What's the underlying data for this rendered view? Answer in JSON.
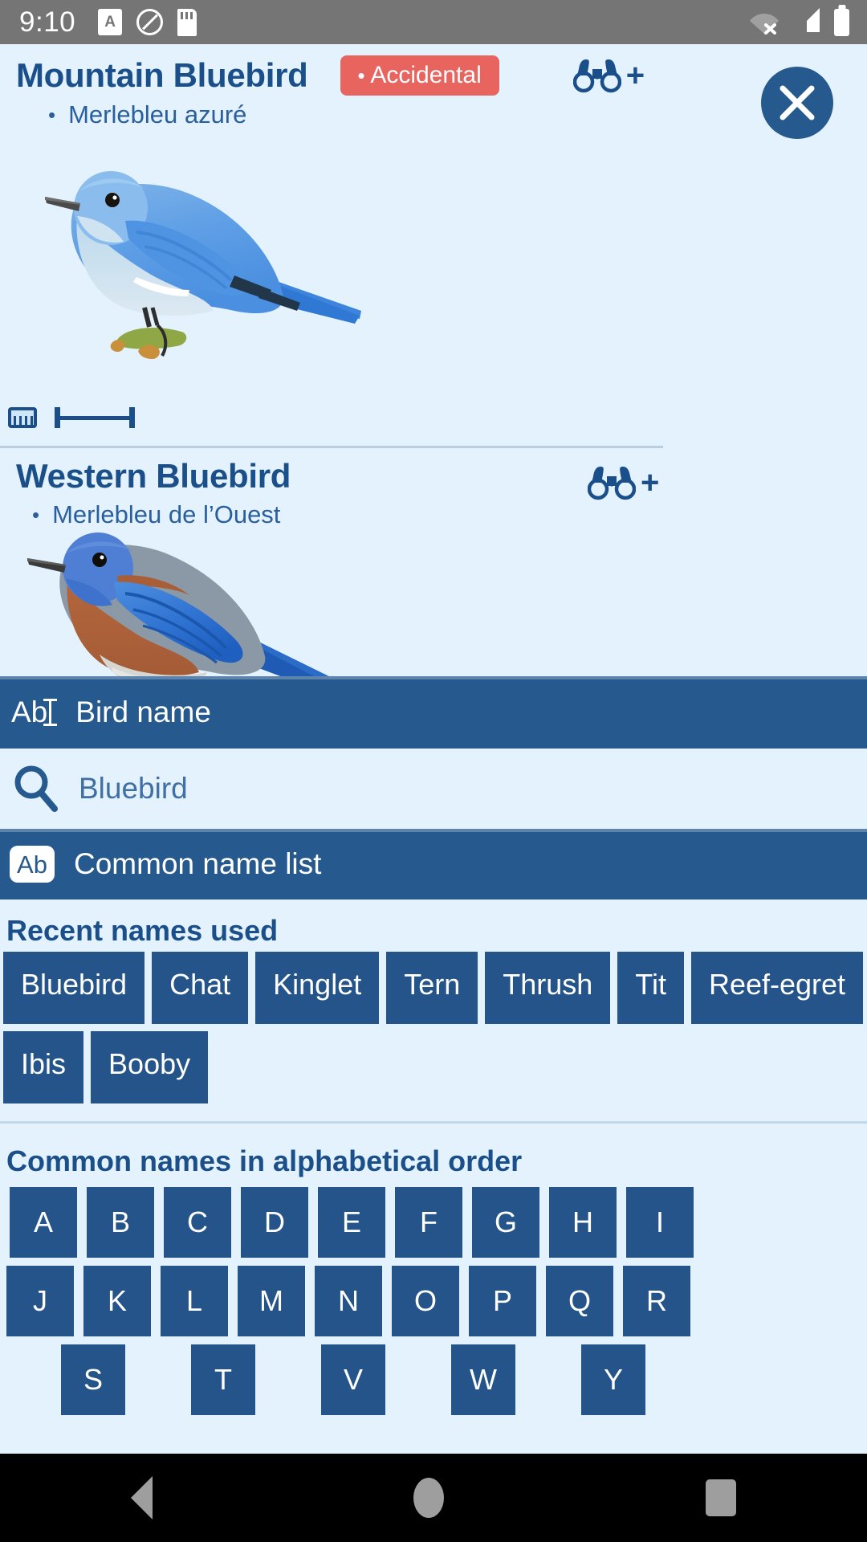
{
  "status_bar": {
    "time": "9:10",
    "left_icons": [
      "font-size-icon",
      "do-not-disturb-icon",
      "sd-card-icon"
    ],
    "right_icons": [
      "wifi-off-icon",
      "cell-signal-icon",
      "battery-icon"
    ],
    "background": "#757575"
  },
  "species": [
    {
      "name": "Mountain Bluebird",
      "badge": "Accidental",
      "badge_color": "#e8655f",
      "french_name": "Merlebleu azuré",
      "observe_icon": "binoculars-add-icon",
      "image": "mountain-bluebird-illustration"
    },
    {
      "name": "Western Bluebird",
      "badge": null,
      "french_name": "Merlebleu de l’Ouest",
      "observe_icon": "binoculars-add-icon",
      "image": "western-bluebird-illustration"
    }
  ],
  "close_button": {
    "icon": "close-icon",
    "color": "#26598e"
  },
  "scale_bar": {
    "icon": "ruler-icon"
  },
  "bird_name_bar": {
    "icon": "text-cursor-icon",
    "icon_label": "Ab",
    "label": "Bird name",
    "background": "#26598e"
  },
  "search": {
    "icon": "search-icon",
    "value": "Bluebird",
    "placeholder": "Bird name"
  },
  "common_name_list_bar": {
    "icon": "ab-badge-icon",
    "icon_label": "Ab",
    "label": "Common name list",
    "background": "#26598e"
  },
  "recent": {
    "heading": "Recent names used",
    "chips": [
      "Bluebird",
      "Chat",
      "Kinglet",
      "Tern",
      "Thrush",
      "Tit",
      "Reef-egret",
      "Ibis",
      "Booby"
    ]
  },
  "alphabetical": {
    "heading": "Common names in alphabetical order",
    "rows": [
      [
        "A",
        "B",
        "C",
        "D",
        "E",
        "F",
        "G",
        "H",
        "I"
      ],
      [
        "J",
        "K",
        "L",
        "M",
        "N",
        "O",
        "P",
        "Q",
        "R"
      ],
      [
        "S",
        "T",
        "V",
        "W",
        "Y"
      ]
    ]
  },
  "nav_bar": {
    "back": "back-icon",
    "home": "home-icon",
    "recents": "recents-icon",
    "background": "#000000"
  },
  "theme": {
    "page_background": "#e3f2fd",
    "accent_blue": "#26598e",
    "chip_blue": "#24548a",
    "title_blue": "#1a4f8a",
    "text_blue": "#2a5f9e"
  }
}
